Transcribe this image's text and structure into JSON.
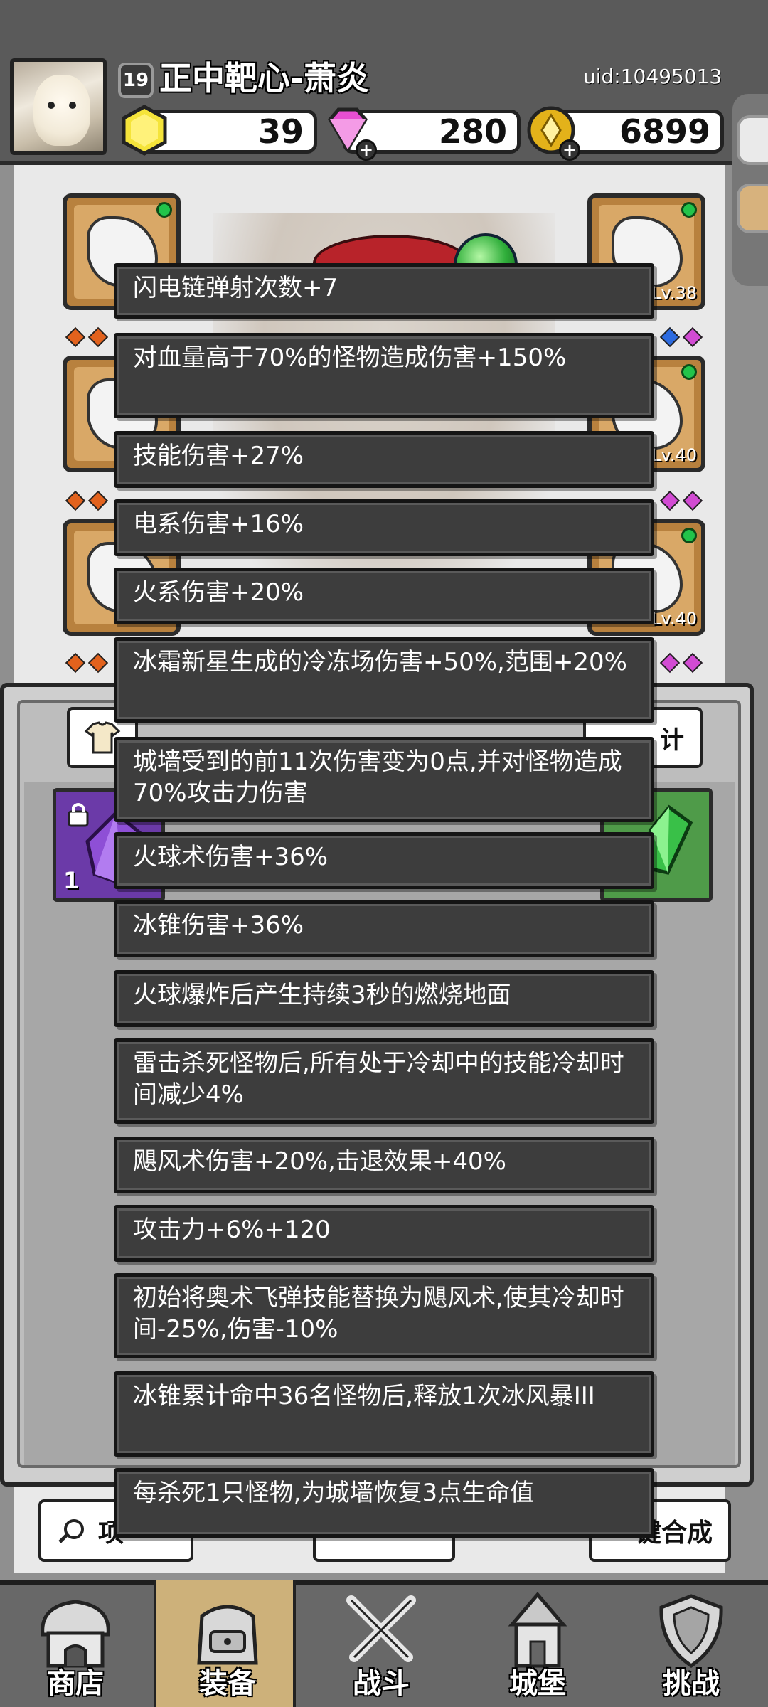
{
  "player": {
    "level": "19",
    "name": "正中靶心-萧炎",
    "uid": "uid:10495013"
  },
  "currencies": [
    {
      "icon": "yellow-gem-icon",
      "value": "39",
      "color": "#f5e43a"
    },
    {
      "icon": "purple-diamond-icon",
      "value": "280",
      "color": "#e84fd2"
    },
    {
      "icon": "gold-coin-icon",
      "value": "6899",
      "color": "#e3b21a"
    }
  ],
  "equipment": {
    "slot_levels": [
      "Lv.38",
      "Lv.40",
      "Lv.40"
    ]
  },
  "panel": {
    "stats_button_partial": "计",
    "gem_count": "1"
  },
  "tooltip": {
    "lines": [
      "闪电链弹射次数+7",
      "对血量高于70%的怪物造成伤害+150%",
      "技能伤害+27%",
      "电系伤害+16%",
      "火系伤害+20%",
      "冰霜新星生成的冷冻场伤害+50%,范围+20%",
      "城墙受到的前11次伤害变为0点,并对怪物造成70%攻击力伤害",
      "火球术伤害+36%",
      "冰锥伤害+36%",
      "火球爆炸后产生持续3秒的燃烧地面",
      "雷击杀死怪物后,所有处于冷却中的技能冷却时间减少4%",
      "飓风术伤害+20%,击退效果+40%",
      "攻击力+6%+120",
      "初始将奥术飞弹技能替换为飓风术,使其冷却时间-25%,伤害-10%",
      "冰锥累计命中36名怪物后,释放1次冰风暴III",
      "每杀死1只怪物,为城墙恢复3点生命值"
    ]
  },
  "bottom_buttons": {
    "left_partial": "项",
    "right_partial": "键合成"
  },
  "nav": [
    {
      "label": "商店",
      "icon": "shop-icon"
    },
    {
      "label": "装备",
      "icon": "backpack-icon"
    },
    {
      "label": "战斗",
      "icon": "crossed-swords-icon"
    },
    {
      "label": "城堡",
      "icon": "castle-tower-icon"
    },
    {
      "label": "挑战",
      "icon": "shield-crest-icon"
    }
  ]
}
